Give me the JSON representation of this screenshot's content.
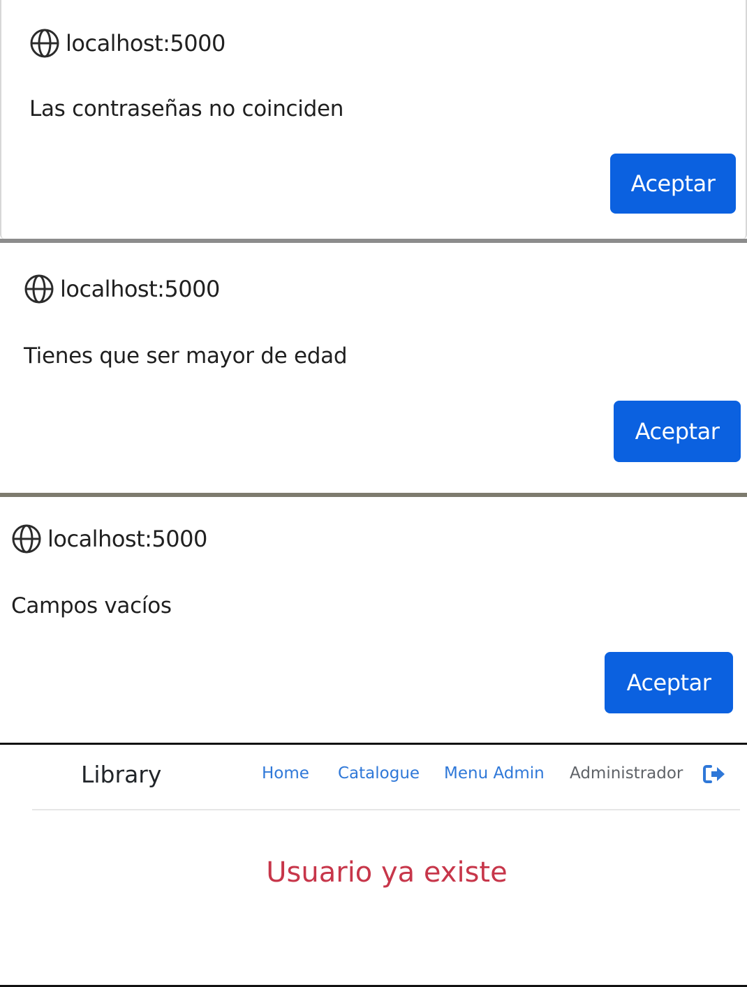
{
  "dialogs": [
    {
      "origin": "localhost:5000",
      "message": "Las contraseñas no coinciden",
      "button_label": "Aceptar",
      "origin_icon": "globe-icon"
    },
    {
      "origin": "localhost:5000",
      "message": "Tienes que ser mayor de edad",
      "button_label": "Aceptar",
      "origin_icon": "globe-icon"
    },
    {
      "origin": "localhost:5000",
      "message": "Campos vacíos",
      "button_label": "Aceptar",
      "origin_icon": "globe-icon"
    }
  ],
  "navbar": {
    "brand": "Library",
    "links": [
      "Home",
      "Catalogue",
      "Menu Admin"
    ],
    "user": "Administrador",
    "logout_icon": "logout-icon"
  },
  "error_message": "Usuario ya existe",
  "colors": {
    "button_blue": "#0b61e0",
    "link_blue": "#2f78d8",
    "error_red": "#c7364a"
  }
}
